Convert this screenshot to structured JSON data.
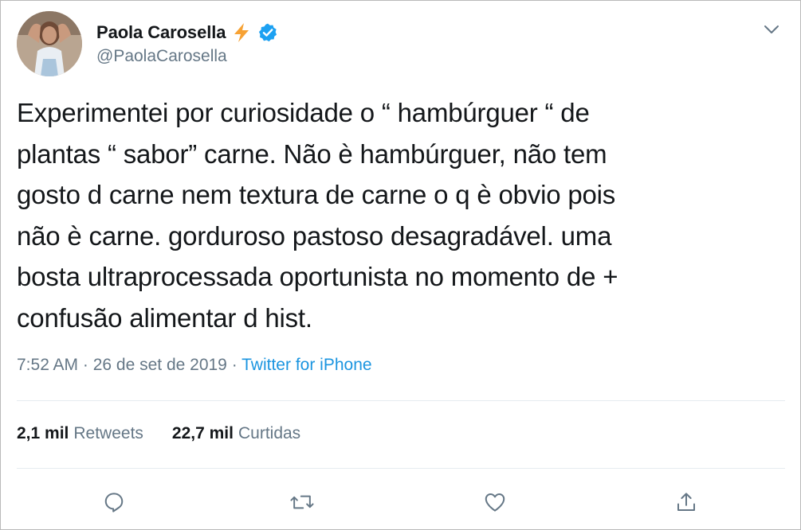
{
  "tweet": {
    "author": {
      "name": "Paola Carosella",
      "handle": "@PaolaCarosella",
      "emoji_icon": "high-voltage-icon",
      "verified_icon": "verified-badge-icon"
    },
    "text": "Experimentei por curiosidade o “ hambúrguer “ de\nplantas “ sabor” carne. Não è hambúrguer, não tem\ngosto d carne nem textura de carne o q è obvio pois\nnão è carne. gorduroso pastoso desagradável.  uma\nbosta ultraprocessada oportunista no momento de +\nconfusão alimentar d hist.",
    "time": "7:52 AM · 26 de set de 2019 · ",
    "source": "Twitter for iPhone",
    "stats": {
      "retweets_count": "2,1 mil",
      "retweets_label": "Retweets",
      "likes_count": "22,7 mil",
      "likes_label": "Curtidas"
    },
    "actions": [
      "reply-icon",
      "retweet-icon",
      "like-icon",
      "share-icon"
    ],
    "colors": {
      "link": "#1b95e0",
      "muted": "#657786",
      "text": "#14171a",
      "verified": "#1da1f2",
      "bolt": "#f7a234"
    }
  }
}
